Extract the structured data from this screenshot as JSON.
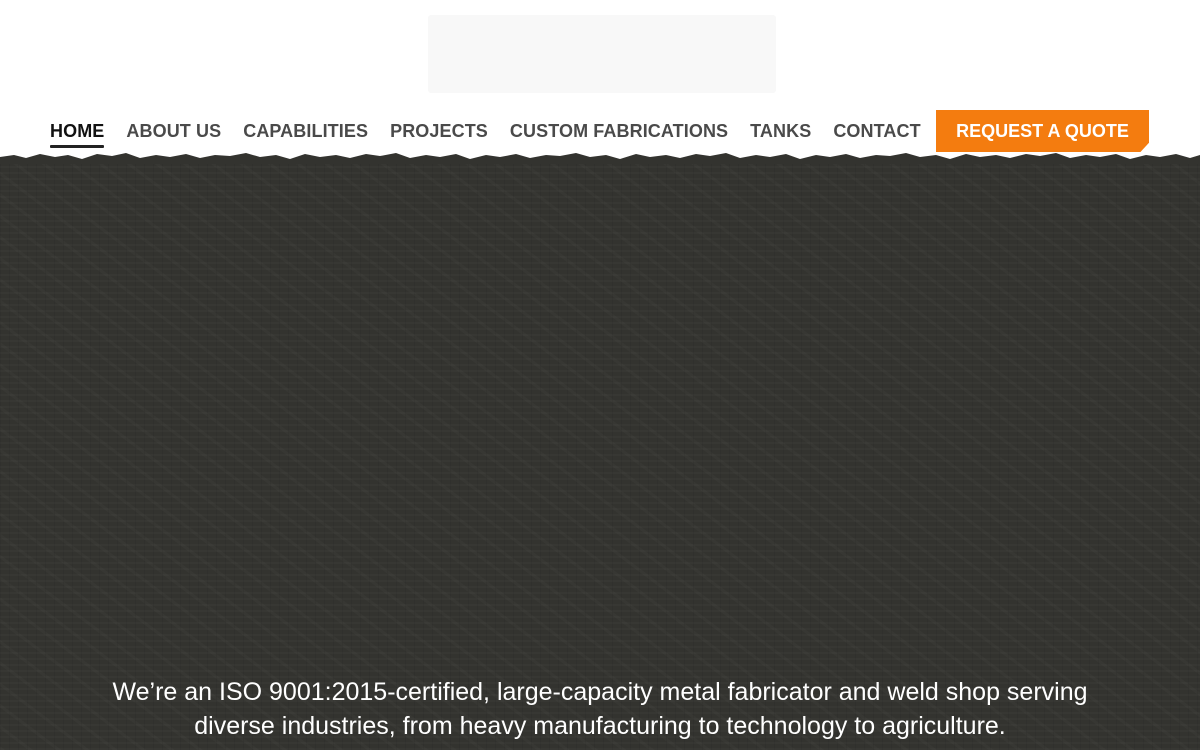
{
  "header": {
    "nav": [
      {
        "label": "HOME",
        "active": true
      },
      {
        "label": "ABOUT US",
        "active": false
      },
      {
        "label": "CAPABILITIES",
        "active": false
      },
      {
        "label": "PROJECTS",
        "active": false
      },
      {
        "label": "CUSTOM FABRICATIONS",
        "active": false
      },
      {
        "label": "TANKS",
        "active": false
      },
      {
        "label": "CONTACT",
        "active": false
      }
    ],
    "cta_label": "REQUEST A QUOTE"
  },
  "hero": {
    "tagline": "We’re an ISO 9001:2015-certified, large-capacity metal fabricator and weld shop serving diverse industries, from heavy manufacturing to technology to agriculture."
  },
  "colors": {
    "accent": "#f47c0f",
    "hero_background": "#33332f",
    "nav_text": "#4a4a4a",
    "nav_active": "#111111"
  }
}
